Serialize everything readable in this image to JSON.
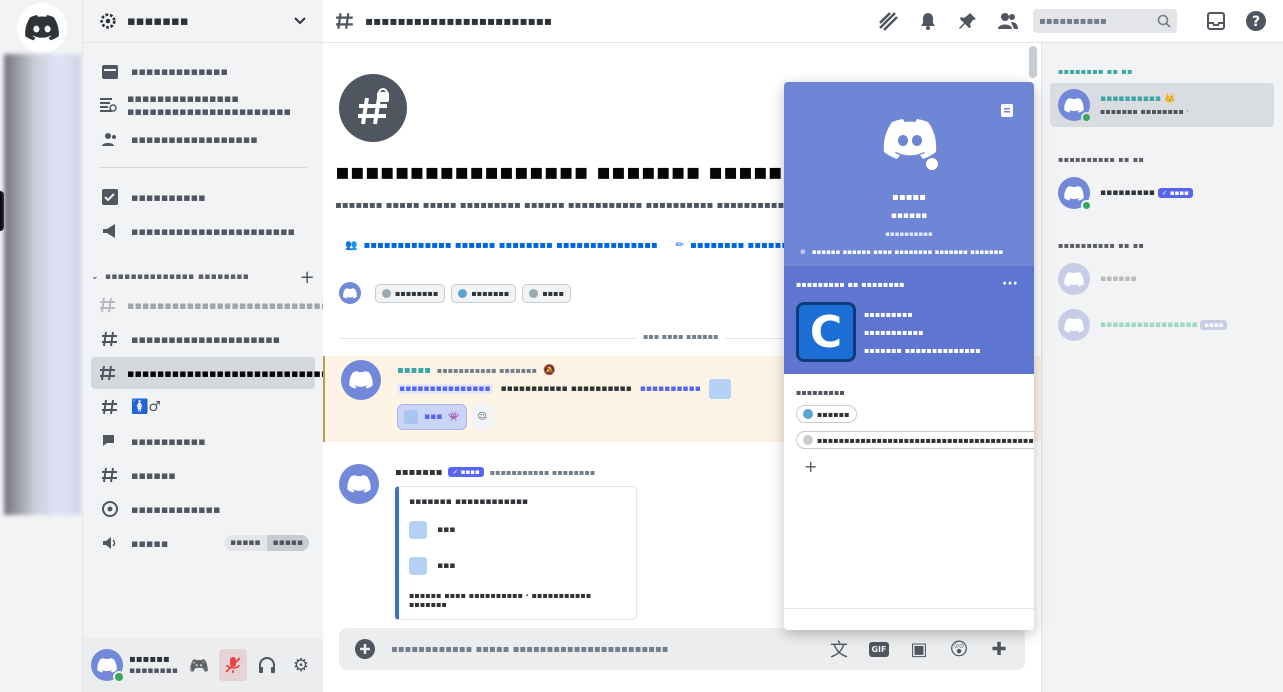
{
  "server_rail": {
    "home_label": "Discord"
  },
  "sidebar": {
    "guild_name": "▪▪▪▪▪▪▪",
    "items": [
      {
        "label": "▪▪▪▪▪▪▪▪▪▪▪▪▪",
        "icon": "calendar-icon"
      },
      {
        "label": "▪▪▪▪▪▪▪▪▪▪▪▪▪▪▪ ▪▪▪▪▪▪▪▪▪▪▪▪▪▪▪▪▪▪▪▪▪▪",
        "icon": "browse-channels-icon"
      },
      {
        "label": "▪▪▪▪▪▪▪▪▪▪▪▪▪▪▪▪▪",
        "icon": "members-icon"
      },
      {
        "label": "▪▪▪▪▪▪▪▪▪▪",
        "icon": "checklist-icon"
      },
      {
        "label": "▪▪▪▪▪▪▪▪▪▪▪▪▪▪▪▪▪▪▪▪▪▪",
        "icon": "megaphone-icon"
      }
    ],
    "category": "▪▪▪▪▪▪▪▪▪▪▪▪▪▪ ▪▪▪▪▪▪▪▪",
    "channels": [
      {
        "label": "▪▪▪▪▪▪▪▪▪▪▪▪▪▪▪▪▪▪▪▪▪▪▪▪▪▪▪▪▪▪▪▪▪▪▪",
        "icon": "hashtag-rules-icon",
        "state": "dim"
      },
      {
        "label": "▪▪▪▪▪▪▪▪▪▪▪▪▪▪▪▪▪▪▪▪",
        "icon": "hashtag-rules-icon",
        "state": "normal"
      },
      {
        "label": "▪▪▪▪▪▪▪▪▪▪▪▪▪▪▪▪▪▪▪▪▪▪▪▪▪▪▪▪▪",
        "icon": "hashtag-locked-icon",
        "state": "active"
      },
      {
        "label": "🚺♂",
        "icon": "hashtag-icon",
        "state": "normal"
      },
      {
        "label": "▪▪▪▪▪▪▪▪▪▪",
        "icon": "forum-icon",
        "state": "normal"
      },
      {
        "label": "▪▪▪▪▪▪",
        "icon": "hashtag-icon",
        "state": "normal"
      },
      {
        "label": "▪▪▪▪▪▪▪▪▪▪▪▪",
        "icon": "stage-icon",
        "state": "normal"
      },
      {
        "label": "▪▪▪▪▪",
        "icon": "speaker-icon",
        "state": "normal"
      }
    ],
    "voice_pill": [
      "▪▪▪▪▪",
      "▪▪▪▪▪"
    ]
  },
  "user_panel": {
    "name": "▪▪▪▪▪▪",
    "status": "▪▪▪▪▪▪▪▪"
  },
  "topbar": {
    "channel": "▪▪▪▪▪▪▪▪▪▪▪▪▪▪▪▪▪▪▪▪▪▪▪",
    "search_placeholder": "▪▪▪▪▪▪▪▪▪▪"
  },
  "welcome": {
    "title": "▪▪▪▪▪▪▪▪▪▪▪▪▪▪▪▪▪ ▪▪▪▪▪▪▪ ▪▪▪▪▪▪▪▪▪▪▪▪▪▪▪▪▪",
    "subtitle": "▪▪▪▪▪▪▪ ▪▪▪▪▪ ▪▪▪▪▪ ▪▪▪▪▪▪▪▪▪ ▪▪▪▪▪▪ ▪▪▪▪▪▪▪▪▪▪▪ ▪▪▪▪▪▪▪▪▪▪ ▪▪▪▪▪▪▪▪▪▪▪▪▪▪▪▪▪",
    "link1": "▪▪▪▪▪▪▪▪▪▪▪▪▪ ▪▪▪▪▪▪ ▪▪▪▪▪▪▪▪ ▪▪▪▪▪▪▪▪▪▪▪▪▪▪▪",
    "link2": "▪▪▪▪▪▪▪▪ ▪▪▪▪▪▪▪▪▪▪▪▪▪▪",
    "tags": [
      {
        "label": "▪▪▪▪▪▪▪▪",
        "color": "#99aab5"
      },
      {
        "label": "▪▪▪▪▪▪▪",
        "color": "#5ba4cf"
      },
      {
        "label": "▪▪▪▪",
        "color": "#99aab5"
      }
    ]
  },
  "date_divider": "▪▪▪ ▪▪▪▪ ▪▪▪▪▪▪",
  "messages": [
    {
      "author": "▪▪▪▪▪",
      "timestamp": "▪▪▪▪▪▪▪▪▪▪▪ ▪▪▪▪▪▪▪",
      "mention": "▪▪▪▪▪▪▪▪▪▪▪▪▪▪▪",
      "text": "▪▪▪▪▪▪▪▪▪▪▪ ▪▪▪▪▪▪▪▪▪▪",
      "link": "▪▪▪▪▪▪▪▪▪▪",
      "reaction_count": "▪▪▪"
    },
    {
      "author": "▪▪▪▪▪▪▪",
      "bot_tag": "▪▪▪▪",
      "timestamp": "▪▪▪▪▪▪▪▪▪▪▪ ▪▪▪▪▪▪▪▪",
      "embed_title": "▪▪▪▪▪▪▪ ▪▪▪▪▪▪▪▪▪▪▪▪",
      "embed_rows": [
        "▪▪▪",
        "▪▪▪"
      ],
      "embed_footer": "▪▪▪▪▪▪ ▪▪▪▪ ▪▪▪▪▪▪▪▪▪▪ · ▪▪▪▪▪▪▪▪▪▪▪ ▪▪▪▪▪▪▪"
    }
  ],
  "composer": {
    "placeholder": "▪▪▪▪▪▪▪▪▪▪▪▪ ▪▪▪▪▪ ▪▪▪▪▪▪▪▪▪▪▪▪▪▪▪▪▪▪▪▪▪▪▪",
    "gif_label": "GIF"
  },
  "members": {
    "group1": "▪▪▪▪▪▪▪▪ ▪▪ ▪▪",
    "group2": "▪▪▪▪▪▪▪▪▪▪ ▪▪ ▪▪",
    "group3": "▪▪▪▪▪▪▪▪▪▪ ▪▪ ▪▪",
    "list": [
      {
        "name": "▪▪▪▪▪▪▪▪▪▪ 👑",
        "sub": "▪▪▪▪▪▪▪ ▪▪▪▪▪▪▪▪ ·",
        "state": "sel"
      },
      {
        "name": "▪▪▪▪▪▪▪▪▪",
        "bot_tag": "▪▪▪▪",
        "state": "online"
      },
      {
        "name": "▪▪▪▪▪▪",
        "state": "off"
      },
      {
        "name": "▪▪▪▪▪▪▪▪▪▪▪▪▪▪▪▪",
        "bot_tag": "▪▪▪▪",
        "state": "off"
      }
    ]
  },
  "popout": {
    "name": "▪▪▪▪▪",
    "tag": "▪▪▪▪▪▪",
    "subtag": "▪▪▪▪▪▪▪▪▪▪",
    "note": "▪▪▪▪▪▪ ▪▪▪▪▪▪ ▪▪▪▪ ▪▪▪▪▪▪▪▪ ▪▪▪▪▪▪▪ ▪▪▪▪▪▪▪",
    "activity_header": "▪▪▪▪▪▪▪▪▪ ▪▪ ▪▪▪▪▪▪▪▪",
    "activity_lines": [
      "▪▪▪▪▪▪▪▪▪",
      "▪▪▪▪▪▪▪▪▪▪▪",
      "▪▪▪▪▪▪▪ ▪▪▪▪▪▪▪▪▪▪▪▪▪▪"
    ],
    "app_letter": "C",
    "roles_label": "▪▪▪▪▪▪▪▪▪",
    "roles": [
      {
        "label": "▪▪▪▪▪▪",
        "color": "#5ba4cf"
      },
      {
        "label": "▪▪▪▪▪▪▪▪▪▪▪▪▪▪▪▪▪▪▪▪▪▪▪▪▪▪▪▪▪▪▪▪▪▪▪▪▪▪▪▪▪▪▪▪▪▪",
        "color": "#c7ccd1"
      }
    ]
  }
}
